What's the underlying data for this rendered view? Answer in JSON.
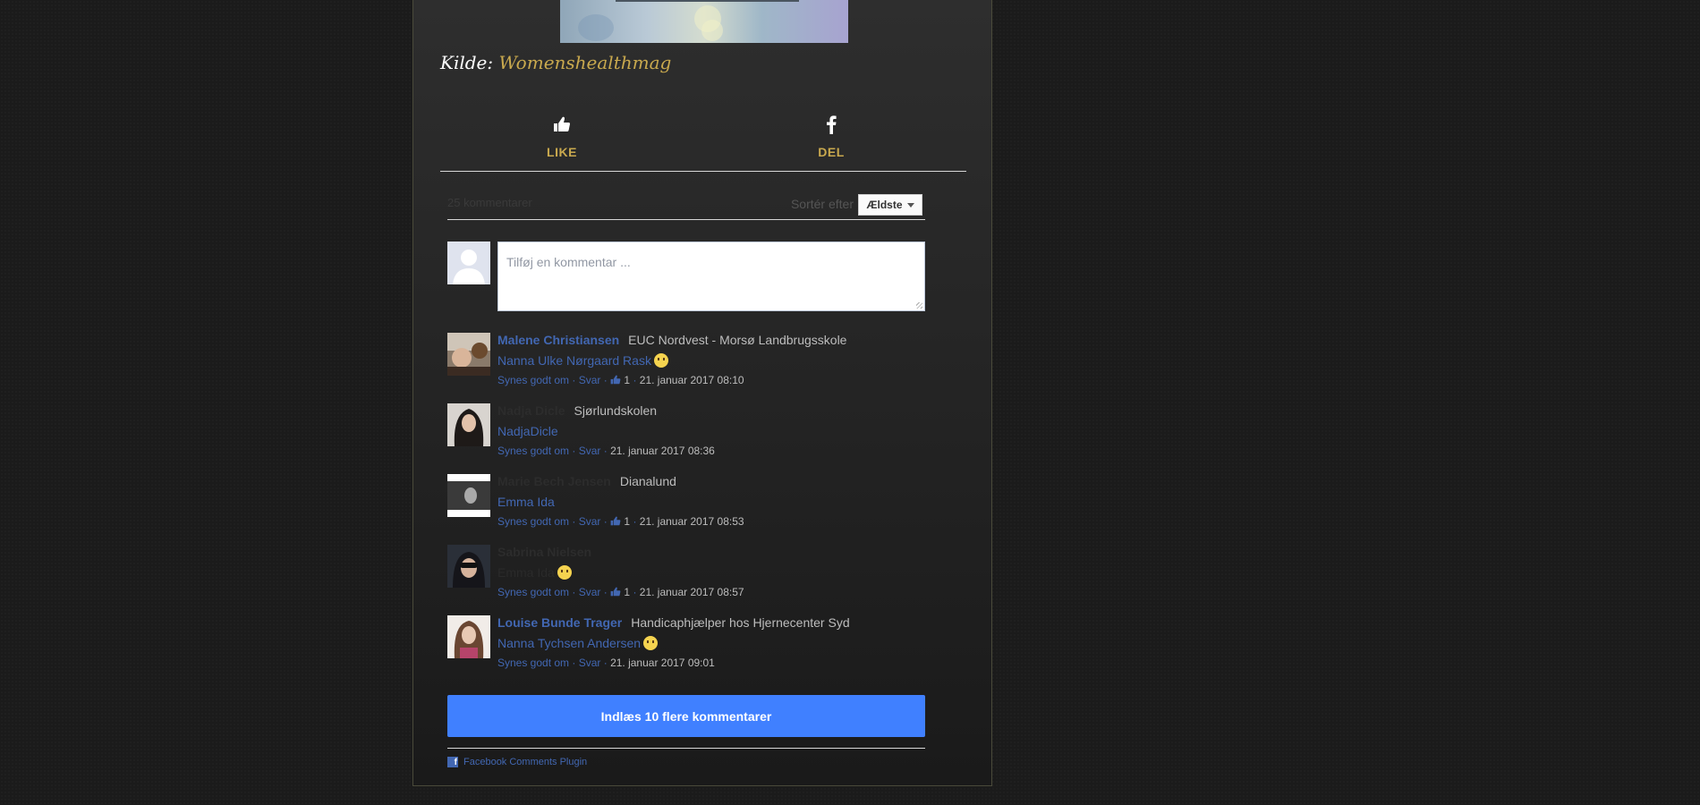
{
  "article": {
    "source_label": "Kilde:",
    "source_link": "Womenshealthmag"
  },
  "actions": {
    "like_label": "LIKE",
    "share_label": "DEL"
  },
  "comments_plugin": {
    "count_text": "25 kommentarer",
    "sort_label": "Sortér efter",
    "sort_value": "Ældste",
    "composer_placeholder": "Tilføj en kommentar ...",
    "like_link": "Synes godt om",
    "reply_link": "Svar",
    "comments": [
      {
        "author": "Malene Christiansen",
        "affiliation": "EUC Nordvest - Morsø Landbrugsskole",
        "text": "Nanna Ulke Nørgaard Rask",
        "emoji": "surprised-emoji",
        "likes": "1",
        "time": "21. januar 2017 08:10"
      },
      {
        "author": "Nadja Dicle",
        "affiliation": "Sjørlundskolen",
        "text": "NadjaDicle",
        "likes": "",
        "time": "21. januar 2017 08:36"
      },
      {
        "author": "Marie Bech Jensen",
        "affiliation": "Dianalund",
        "text": "Emma Ida",
        "likes": "1",
        "time": "21. januar 2017 08:53"
      },
      {
        "author": "Sabrina Nielsen",
        "affiliation": "",
        "text": "Emma Ida",
        "emoji": "sad-emoji",
        "likes": "1",
        "time": "21. januar 2017 08:57"
      },
      {
        "author": "Louise Bunde Trager",
        "affiliation": "Handicaphjælper hos Hjernecenter Syd",
        "text": "Nanna Tychsen Andersen",
        "emoji": "flushed-emoji",
        "likes": "",
        "time": "21. januar 2017 09:01"
      }
    ],
    "load_more_label": "Indlæs 10 flere kommentarer",
    "footer_label": "Facebook Comments Plugin"
  }
}
